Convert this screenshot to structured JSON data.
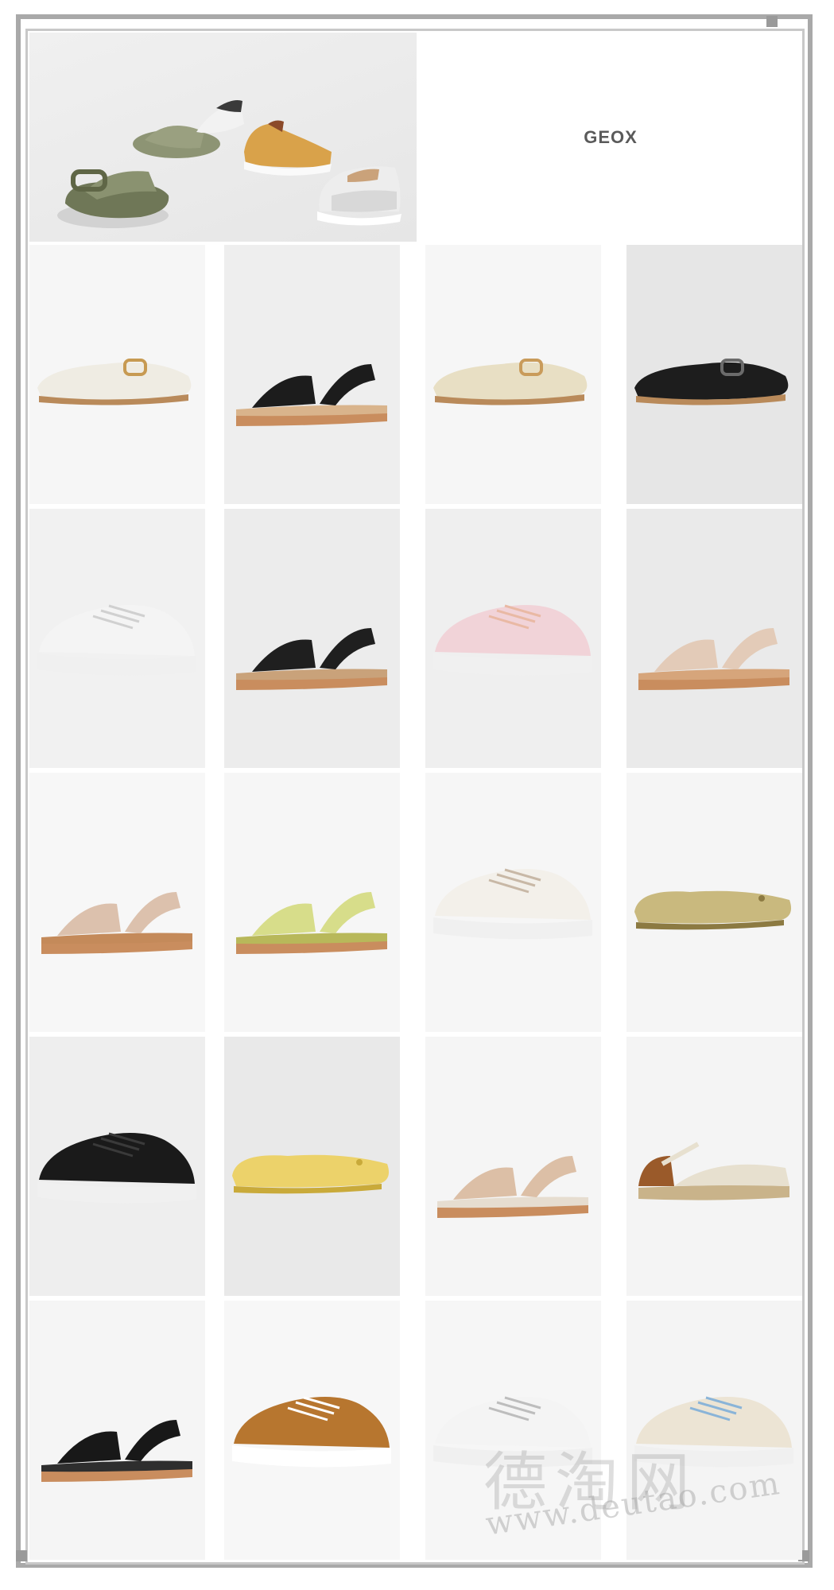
{
  "brand": {
    "logo_text": "GEOX"
  },
  "watermark": {
    "chars": "德淘网",
    "url": "www.deutao.com"
  },
  "hero": {
    "shoes": [
      "olive-strap-sandal",
      "olive-slide",
      "black-white-sneaker",
      "mustard-sneaker",
      "grey-white-sneaker"
    ]
  },
  "products": [
    {
      "name": "cream-buckle-loafer",
      "bg": "#f6f6f6",
      "color": "#efece3",
      "accent": "#c79a52",
      "type": "loafer"
    },
    {
      "name": "black-strap-sandal",
      "bg": "#eeeeee",
      "color": "#1c1c1c",
      "accent": "#d9b48c",
      "type": "sandal"
    },
    {
      "name": "beige-buckle-mule",
      "bg": "#f6f6f6",
      "color": "#e8dfc4",
      "accent": "#c99b5a",
      "type": "mule"
    },
    {
      "name": "black-moccasin",
      "bg": "#e6e6e6",
      "color": "#1d1d1d",
      "accent": "#6b6b6b",
      "type": "loafer"
    },
    {
      "name": "white-knit-sneaker",
      "bg": "#f1f1f1",
      "color": "#f4f4f4",
      "accent": "#d0d0d0",
      "type": "sneaker"
    },
    {
      "name": "black-cross-sandal",
      "bg": "#ececec",
      "color": "#1f1f1f",
      "accent": "#c9a27a",
      "type": "sandal"
    },
    {
      "name": "pink-knit-sneaker",
      "bg": "#efefef",
      "color": "#f1d3d8",
      "accent": "#e9b9a4",
      "type": "sneaker"
    },
    {
      "name": "rose-gold-cross-sandal",
      "bg": "#eaeaea",
      "color": "#e3cbb8",
      "accent": "#d6a57b",
      "type": "sandal"
    },
    {
      "name": "rose-gold-strap-sandal",
      "bg": "#f7f7f7",
      "color": "#dcc1ad",
      "accent": "#c48a5a",
      "type": "sandal"
    },
    {
      "name": "lime-block-sandal",
      "bg": "#f6f6f6",
      "color": "#d7dd8a",
      "accent": "#b8b85a",
      "type": "sandal"
    },
    {
      "name": "white-quilted-sneaker",
      "bg": "#f6f6f6",
      "color": "#f3f0ea",
      "accent": "#c8b8a6",
      "type": "sneaker"
    },
    {
      "name": "gold-ballet-flat",
      "bg": "#f5f5f5",
      "color": "#c9b97e",
      "accent": "#8c7a42",
      "type": "flat"
    },
    {
      "name": "black-knit-sneaker",
      "bg": "#eeeeee",
      "color": "#1a1a1a",
      "accent": "#3a3a3a",
      "type": "sneaker"
    },
    {
      "name": "yellow-ballet-flat",
      "bg": "#e9e9e9",
      "color": "#ecd26a",
      "accent": "#c9aa3a",
      "type": "flat"
    },
    {
      "name": "rose-gold-sport-sandal",
      "bg": "#f5f5f5",
      "color": "#dcbfa6",
      "accent": "#e6ddd0",
      "type": "sandal"
    },
    {
      "name": "cream-espadrille",
      "bg": "#f4f4f4",
      "color": "#e7e0cf",
      "accent": "#9a5a2a",
      "type": "espadrille"
    },
    {
      "name": "black-sport-sandal",
      "bg": "#f5f5f5",
      "color": "#181818",
      "accent": "#2e2e2e",
      "type": "sandal"
    },
    {
      "name": "tan-suede-sneaker",
      "bg": "#f7f7f7",
      "color": "#b7762f",
      "accent": "#ffffff",
      "type": "sneaker"
    },
    {
      "name": "white-silver-sneaker",
      "bg": "#f6f6f6",
      "color": "#f4f4f4",
      "accent": "#bdbdbd",
      "type": "sneaker"
    },
    {
      "name": "cream-blue-runner",
      "bg": "#f4f4f4",
      "color": "#ece4d4",
      "accent": "#8ab4d8",
      "type": "sneaker"
    }
  ]
}
